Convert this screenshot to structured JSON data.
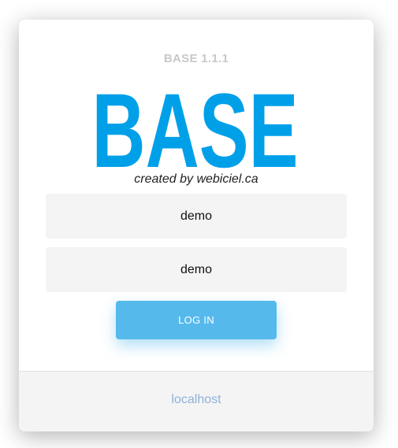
{
  "header": {
    "version": "BASE 1.1.1",
    "logo_text": "BASE",
    "credit": "created by webiciel.ca"
  },
  "form": {
    "username_value": "demo",
    "password_value": "demo",
    "login_label": "LOG IN"
  },
  "footer": {
    "host_link": "localhost"
  },
  "colors": {
    "brand": "#00a0e9",
    "button": "#56b9ec",
    "link": "#8fb1d9",
    "field_bg": "#f4f4f4"
  }
}
